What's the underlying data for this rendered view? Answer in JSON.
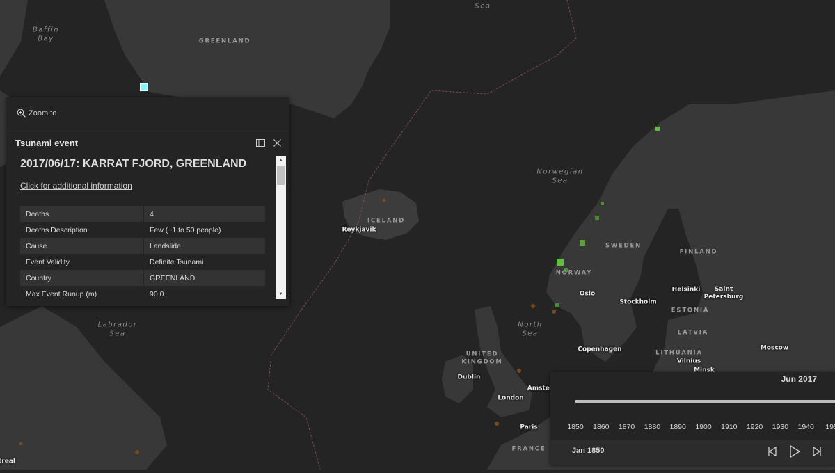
{
  "map": {
    "sea_labels": [
      "Baffin\nBay",
      "Norwegian\nSea",
      "Labrador\nSea",
      "North\nSea",
      "Greenland\nSea"
    ],
    "country_labels": [
      "GREENLAND",
      "ICELAND",
      "SWEDEN",
      "FINLAND",
      "NORWAY",
      "ESTONIA",
      "LATVIA",
      "LITHUANIA",
      "UNITED\nKINGDOM",
      "FRANCE"
    ],
    "city_labels": [
      "Reykjavik",
      "Oslo",
      "Stockholm",
      "Helsinki",
      "Saint\nPetersburg",
      "Copenhagen",
      "Moscow",
      "Vilnius",
      "Minsk",
      "Dublin",
      "Amster",
      "London",
      "Paris",
      "treal"
    ],
    "colors": {
      "water": "#242424",
      "land": "#383838",
      "selected_event": "#7ff7ff",
      "tsunami_event": "#5fbf3a",
      "other_event": "#7a4a1f"
    }
  },
  "popup": {
    "zoom_label": "Zoom to",
    "zoom_icon": "zoom-in-icon",
    "title": "Tsunami event",
    "dock_icon": "dock-icon",
    "close_icon": "close-icon",
    "event_heading": "2017/06/17: KARRAT FJORD, GREENLAND",
    "more_info_link": "Click for additional information",
    "attributes": [
      {
        "label": "Deaths",
        "value": "4"
      },
      {
        "label": "Deaths Description",
        "value": "Few (~1 to 50 people)"
      },
      {
        "label": "Cause",
        "value": "Landslide"
      },
      {
        "label": "Event Validity",
        "value": "Definite Tsunami"
      },
      {
        "label": "Country",
        "value": "GREENLAND"
      },
      {
        "label": "Max Event Runup (m)",
        "value": "90.0"
      }
    ]
  },
  "time_slider": {
    "current_time": "Jun 2017",
    "start_time": "Jan 1850",
    "ticks": [
      "1850",
      "1860",
      "1870",
      "1880",
      "1890",
      "1900",
      "1910",
      "1920",
      "1930",
      "1940",
      "195"
    ],
    "buttons": {
      "previous": "previous-icon",
      "play": "play-icon",
      "next": "next-icon"
    }
  }
}
